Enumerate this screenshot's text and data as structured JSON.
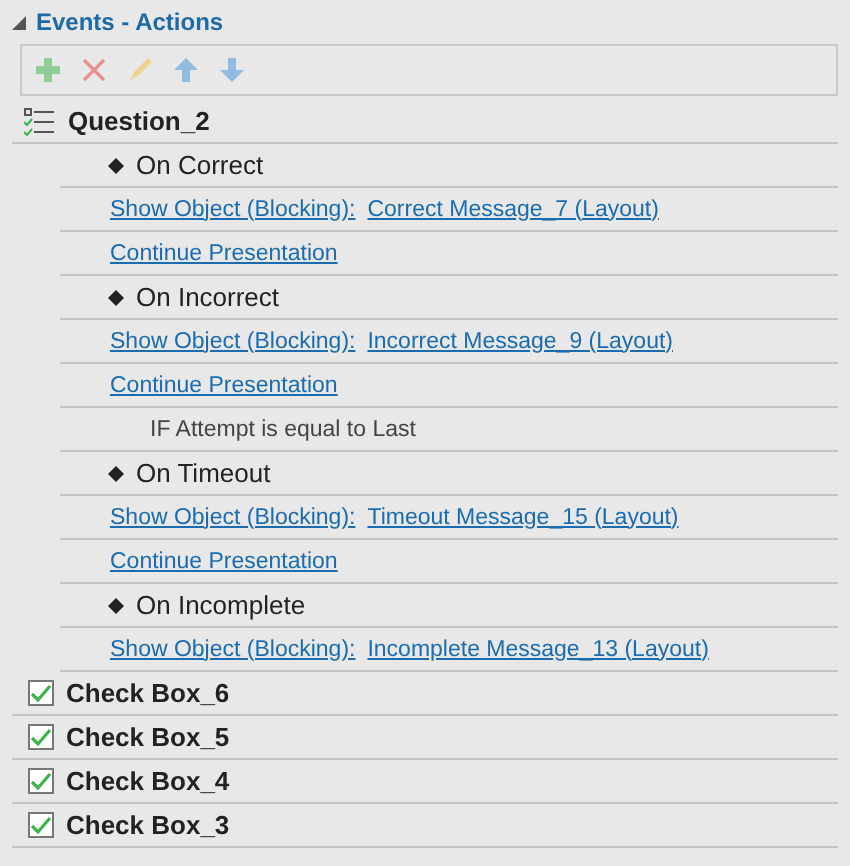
{
  "panel": {
    "title": "Events - Actions",
    "expanded": true
  },
  "toolbar": [
    {
      "kind": "add",
      "disabled": true
    },
    {
      "kind": "delete",
      "disabled": true
    },
    {
      "kind": "edit",
      "disabled": true
    },
    {
      "kind": "up",
      "disabled": true
    },
    {
      "kind": "down",
      "disabled": true
    }
  ],
  "rows": [
    {
      "kind": "group",
      "label": "Question_2"
    },
    {
      "kind": "event",
      "label": "On Correct"
    },
    {
      "kind": "action",
      "label": "Show Object (Blocking):",
      "target": "Correct Message_7 (Layout)"
    },
    {
      "kind": "action",
      "label": "Continue Presentation"
    },
    {
      "kind": "event",
      "label": "On Incorrect"
    },
    {
      "kind": "action",
      "label": "Show Object (Blocking):",
      "target": "Incorrect Message_9 (Layout)"
    },
    {
      "kind": "action",
      "label": "Continue Presentation"
    },
    {
      "kind": "condition",
      "label": "IF Attempt is equal to Last"
    },
    {
      "kind": "event",
      "label": "On Timeout"
    },
    {
      "kind": "action",
      "label": "Show Object (Blocking):",
      "target": "Timeout Message_15 (Layout)"
    },
    {
      "kind": "action",
      "label": "Continue Presentation"
    },
    {
      "kind": "event",
      "label": "On Incomplete"
    },
    {
      "kind": "action",
      "label": "Show Object (Blocking):",
      "target": "Incomplete Message_13 (Layout)"
    },
    {
      "kind": "checkbox",
      "label": "Check Box_6",
      "checked": true
    },
    {
      "kind": "checkbox",
      "label": "Check Box_5",
      "checked": true
    },
    {
      "kind": "checkbox",
      "label": "Check Box_4",
      "checked": true
    },
    {
      "kind": "checkbox",
      "label": "Check Box_3",
      "checked": true
    }
  ]
}
